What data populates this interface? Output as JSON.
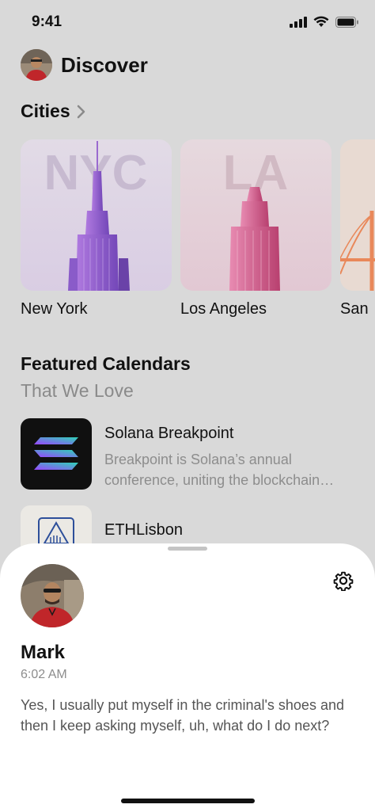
{
  "status_bar": {
    "time": "9:41"
  },
  "header": {
    "title": "Discover"
  },
  "cities": {
    "title": "Cities",
    "items": [
      {
        "label": "New York",
        "overlay": "NYC"
      },
      {
        "label": "Los Angeles",
        "overlay": "LA"
      },
      {
        "label": "San"
      }
    ]
  },
  "featured": {
    "title": "Featured Calendars",
    "subtitle": "That We Love",
    "items": [
      {
        "name": "Solana Breakpoint",
        "description_line1": "Breakpoint is Solana’s annual",
        "description_line2": "conference, uniting the blockchain…"
      },
      {
        "name": "ETHLisbon"
      }
    ]
  },
  "sheet": {
    "name": "Mark",
    "time": "6:02 AM",
    "message": "Yes, I usually put myself in the criminal's shoes and then I keep asking myself, uh, what do I do next?"
  },
  "colors": {
    "background": "#d9d9d9",
    "nyc_purple": "#a77ad6",
    "la_pink": "#d8649a",
    "sf_orange": "#e9885a",
    "solana_bg": "#101010",
    "solana_teal": "#2ed3b7",
    "solana_purple": "#9a45ff"
  }
}
